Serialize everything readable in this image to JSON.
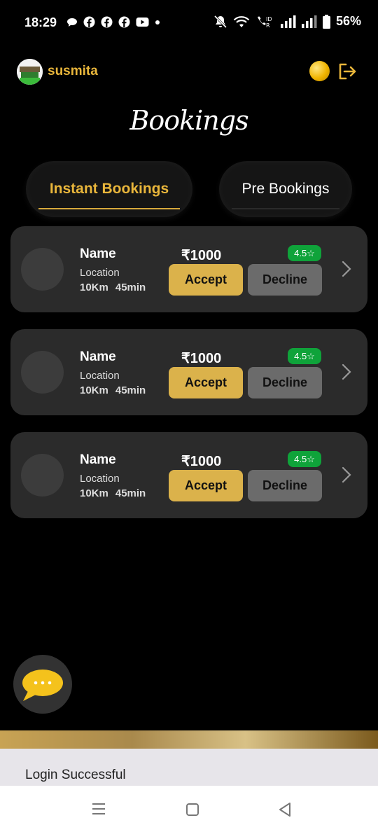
{
  "status_bar": {
    "time": "18:29",
    "battery": "56%",
    "notification_icons": [
      "message-icon",
      "facebook-icon",
      "facebook-icon",
      "facebook-icon",
      "youtube-icon",
      "dot-icon"
    ],
    "system_icons": [
      "bell-muted-icon",
      "wifi-icon",
      "volte-icon",
      "signal-icon",
      "signal-icon",
      "battery-icon"
    ]
  },
  "header": {
    "username": "susmita",
    "accent_color": "#e9b63b"
  },
  "page_title": "Bookings",
  "tabs": [
    {
      "label": "Instant Bookings",
      "active": true
    },
    {
      "label": "Pre Bookings",
      "active": false
    }
  ],
  "bookings": [
    {
      "name": "Name",
      "location": "Location",
      "distance": "10Km",
      "duration": "45min",
      "price": "₹1000",
      "rating": "4.5☆",
      "accept_label": "Accept",
      "decline_label": "Decline"
    },
    {
      "name": "Name",
      "location": "Location",
      "distance": "10Km",
      "duration": "45min",
      "price": "₹1000",
      "rating": "4.5☆",
      "accept_label": "Accept",
      "decline_label": "Decline"
    },
    {
      "name": "Name",
      "location": "Location",
      "distance": "10Km",
      "duration": "45min",
      "price": "₹1000",
      "rating": "4.5☆",
      "accept_label": "Accept",
      "decline_label": "Decline"
    }
  ],
  "toast": {
    "message": "Login Successful"
  },
  "colors": {
    "accept": "#dbb24b",
    "decline": "#6b6b6b",
    "rating_badge": "#0fa33a",
    "card": "#2b2b2b"
  }
}
